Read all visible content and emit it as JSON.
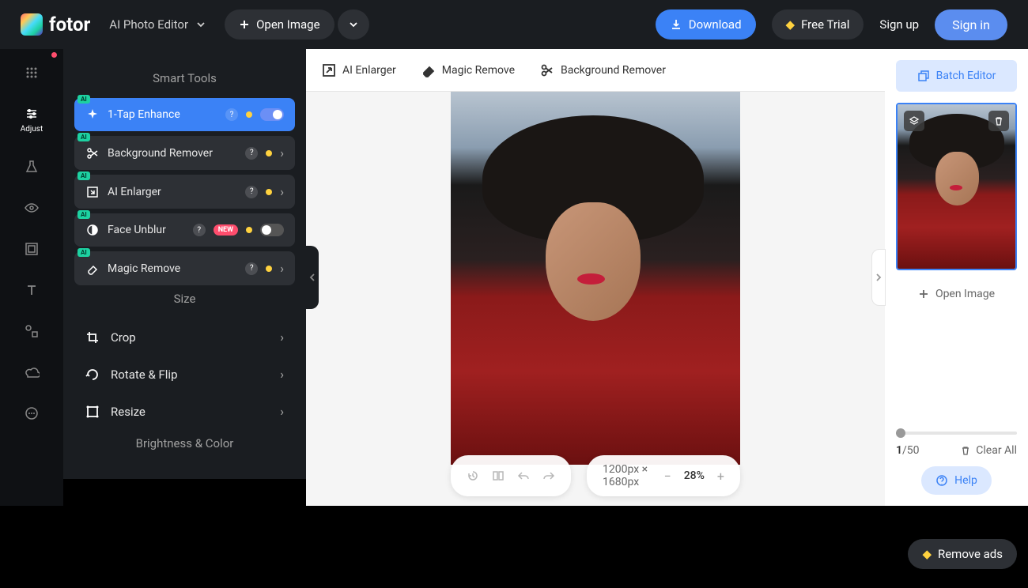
{
  "header": {
    "brand": "fotor",
    "editor_dropdown": "AI Photo Editor",
    "open_image": "Open Image",
    "download": "Download",
    "free_trial": "Free Trial",
    "sign_up": "Sign up",
    "sign_in": "Sign in"
  },
  "rail": {
    "adjust": "Adjust"
  },
  "sidebar": {
    "smart_tools_title": "Smart Tools",
    "tools": [
      {
        "label": "1-Tap Enhance"
      },
      {
        "label": "Background Remover"
      },
      {
        "label": "AI Enlarger"
      },
      {
        "label": "Face Unblur"
      },
      {
        "label": "Magic Remove"
      }
    ],
    "new_badge": "NEW",
    "size_title": "Size",
    "size_items": [
      {
        "label": "Crop"
      },
      {
        "label": "Rotate & Flip"
      },
      {
        "label": "Resize"
      }
    ],
    "brightness_title": "Brightness & Color"
  },
  "canvas": {
    "toolbar": [
      {
        "label": "AI Enlarger"
      },
      {
        "label": "Magic Remove"
      },
      {
        "label": "Background Remover"
      }
    ],
    "dimensions": "1200px × 1680px",
    "zoom": "28%"
  },
  "right": {
    "batch_editor": "Batch Editor",
    "open_image": "Open Image",
    "counter_current": "1",
    "counter_total": "/50",
    "clear_all": "Clear All",
    "help": "Help"
  },
  "footer": {
    "remove_ads": "Remove ads"
  }
}
